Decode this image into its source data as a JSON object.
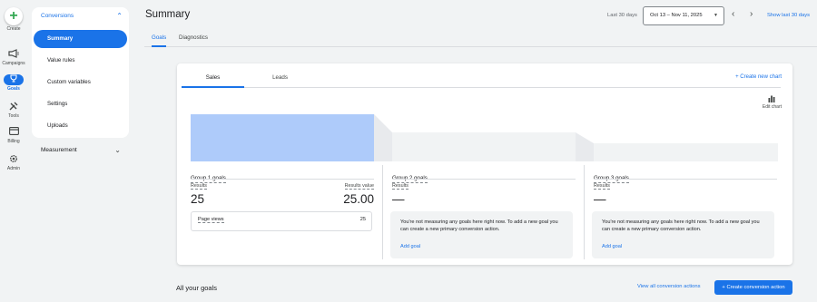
{
  "rail": {
    "create_label": "Create",
    "campaigns_label": "Campaigns",
    "goals_label": "Goals",
    "tools_label": "Tools",
    "billing_label": "Billing",
    "admin_label": "Admin"
  },
  "subnav": {
    "section_label": "Conversions",
    "items": [
      {
        "label": "Summary"
      },
      {
        "label": "Value rules"
      },
      {
        "label": "Custom variables"
      },
      {
        "label": "Settings"
      },
      {
        "label": "Uploads"
      }
    ],
    "measurement_label": "Measurement"
  },
  "header": {
    "title": "Summary",
    "range_label": "Last 30 days",
    "date_range": "Oct 13 – Nov 11, 2025",
    "show_last_label": "Show last 30 days"
  },
  "page_tabs": [
    {
      "label": "Goals"
    },
    {
      "label": "Diagnostics"
    }
  ],
  "card": {
    "tabs": [
      {
        "label": "Sales"
      },
      {
        "label": "Leads"
      }
    ],
    "new_chart_label": "Create new chart",
    "edit_chart_label": "Edit chart",
    "chart_fill": [
      1.0,
      0.62,
      0.37
    ],
    "groups": [
      {
        "title": "Group 1 goals",
        "results_label": "Results",
        "results_value": "25",
        "value_label": "Results value",
        "value_value": "25.00",
        "row_label": "Page views",
        "row_value": "25"
      },
      {
        "title": "Group 2 goals",
        "results_label": "Results",
        "results_value": "—",
        "message": "You're not measuring any goals here right now. To add a new goal you can create a new primary conversion action.",
        "add_label": "Add goal"
      },
      {
        "title": "Group 3 goals",
        "results_label": "Results",
        "results_value": "—",
        "message": "You're not measuring any goals here right now. To add a new goal you can create a new primary conversion action.",
        "add_label": "Add goal"
      }
    ]
  },
  "bottom": {
    "all_goals_title": "All your goals",
    "view_all_label": "View all conversion actions",
    "create_button_label": "Create conversion action"
  },
  "colors": {
    "accent": "#1a73e8",
    "bar_primary": "#aecbfa",
    "bar_muted": "#e8eaed"
  }
}
